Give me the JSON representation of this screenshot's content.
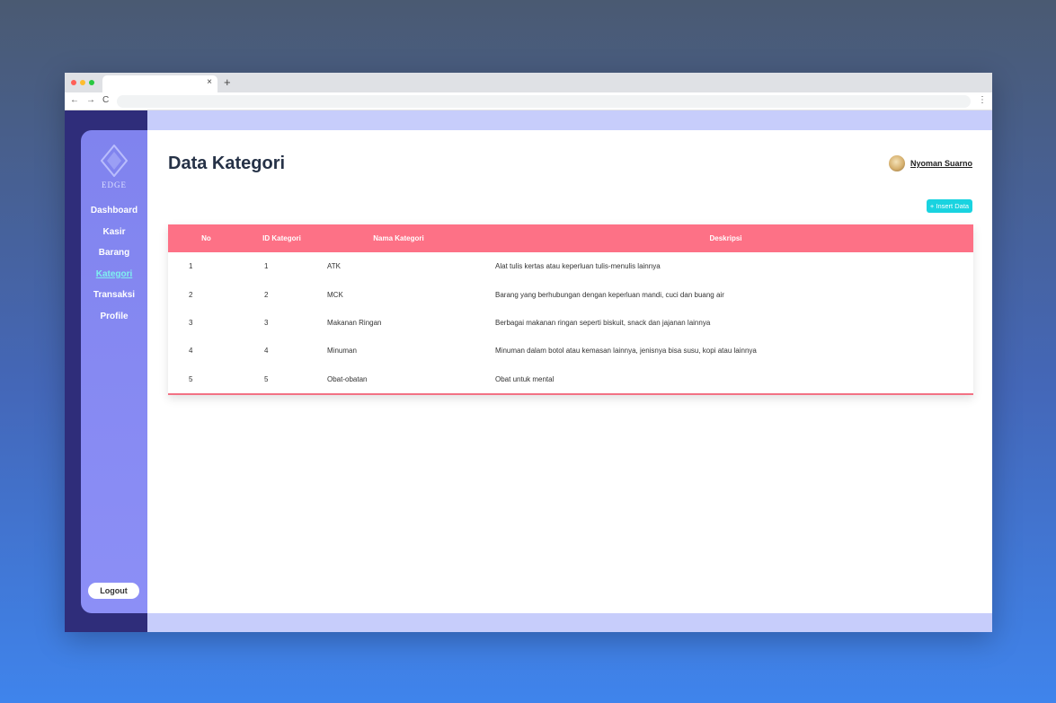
{
  "colors": {
    "sidebar": "#8083ee",
    "table_header": "#fd7186",
    "insert_button": "#19d3e0",
    "active_menu": "#7ff0f0",
    "title": "#263247"
  },
  "browser": {
    "tab_close": "×",
    "new_tab": "+",
    "back": "←",
    "forward": "→",
    "reload": "C",
    "menu": "⋮"
  },
  "sidebar": {
    "logo_text": "EDGE",
    "items": [
      {
        "label": "Dashboard"
      },
      {
        "label": "Kasir"
      },
      {
        "label": "Barang"
      },
      {
        "label": "Kategori",
        "active": true
      },
      {
        "label": "Transaksi"
      },
      {
        "label": "Profile"
      }
    ],
    "logout_label": "Logout"
  },
  "header": {
    "title": "Data Kategori",
    "user_name": "Nyoman Suarno"
  },
  "insert_label": "+ Insert Data",
  "table": {
    "headers": [
      "No",
      "ID Kategori",
      "Nama Kategori",
      "Deskripsi"
    ],
    "rows": [
      [
        "1",
        "1",
        "ATK",
        "Alat tulis kertas atau keperluan tulis-menulis lainnya"
      ],
      [
        "2",
        "2",
        "MCK",
        "Barang yang berhubungan dengan keperluan mandi, cuci dan buang air"
      ],
      [
        "3",
        "3",
        "Makanan Ringan",
        "Berbagai makanan ringan seperti biskuit, snack dan jajanan lainnya"
      ],
      [
        "4",
        "4",
        "Minuman",
        "Minuman dalam botol atau kemasan lainnya, jenisnya bisa susu, kopi atau lainnya"
      ],
      [
        "5",
        "5",
        "Obat-obatan",
        "Obat untuk mental"
      ]
    ]
  }
}
